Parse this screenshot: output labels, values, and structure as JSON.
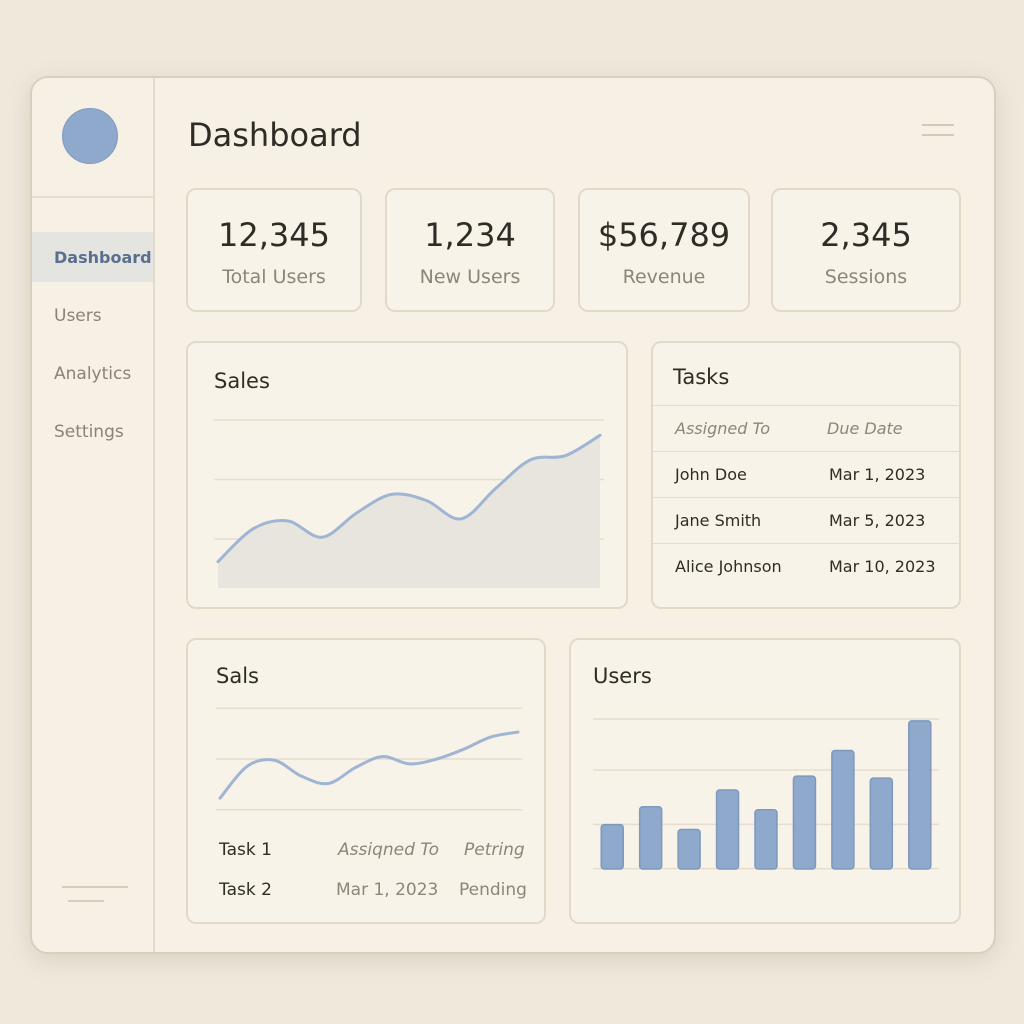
{
  "sidebar": {
    "items": [
      {
        "label": "Dashboard",
        "active": true
      },
      {
        "label": "Users",
        "active": false
      },
      {
        "label": "Analytics",
        "active": false
      },
      {
        "label": "Settings",
        "active": false
      }
    ]
  },
  "header": {
    "title": "Dashboard"
  },
  "stats": [
    {
      "value": "12,345",
      "label": "Total Users"
    },
    {
      "value": "1,234",
      "label": "New Users"
    },
    {
      "value": "$56,789",
      "label": "Revenue"
    },
    {
      "value": "2,345",
      "label": "Sessions"
    }
  ],
  "sales_card": {
    "title": "Sales"
  },
  "tasks_card": {
    "title": "Tasks",
    "columns": [
      "Assigned To",
      "Due Date"
    ],
    "rows": [
      [
        "John Doe",
        "Mar 1, 2023"
      ],
      [
        "Jane Smith",
        "Mar 5, 2023"
      ],
      [
        "Alice Johnson",
        "Mar 10, 2023"
      ]
    ]
  },
  "sals_card": {
    "title": "Sals",
    "rows": [
      [
        "Task 1",
        "Assiqned To",
        "Petring"
      ],
      [
        "Task 2",
        "Mar 1, 2023",
        "Pending"
      ]
    ]
  },
  "users_card": {
    "title": "Users"
  },
  "colors": {
    "accent": "#8fa9cc",
    "line": "#9fb5d3",
    "background": "#f7f1e5"
  },
  "chart_data": [
    {
      "type": "area",
      "x": [
        0,
        1,
        2,
        3,
        4,
        5,
        6,
        7,
        8,
        9,
        10,
        11
      ],
      "values": [
        10,
        26,
        30,
        22,
        34,
        43,
        40,
        31,
        46,
        60,
        62,
        72
      ],
      "ylim": [
        0,
        80
      ],
      "grid": true
    },
    {
      "type": "line",
      "x": [
        0,
        1,
        2,
        3,
        4,
        5,
        6,
        7,
        8,
        9,
        10,
        11
      ],
      "values": [
        8,
        34,
        39,
        26,
        20,
        33,
        42,
        36,
        40,
        48,
        58,
        62
      ],
      "ylim": [
        0,
        80
      ],
      "grid": true
    },
    {
      "type": "bar",
      "values": [
        45,
        63,
        40,
        80,
        60,
        94,
        120,
        92,
        150
      ],
      "ylim": [
        0,
        160
      ],
      "grid": true
    }
  ]
}
